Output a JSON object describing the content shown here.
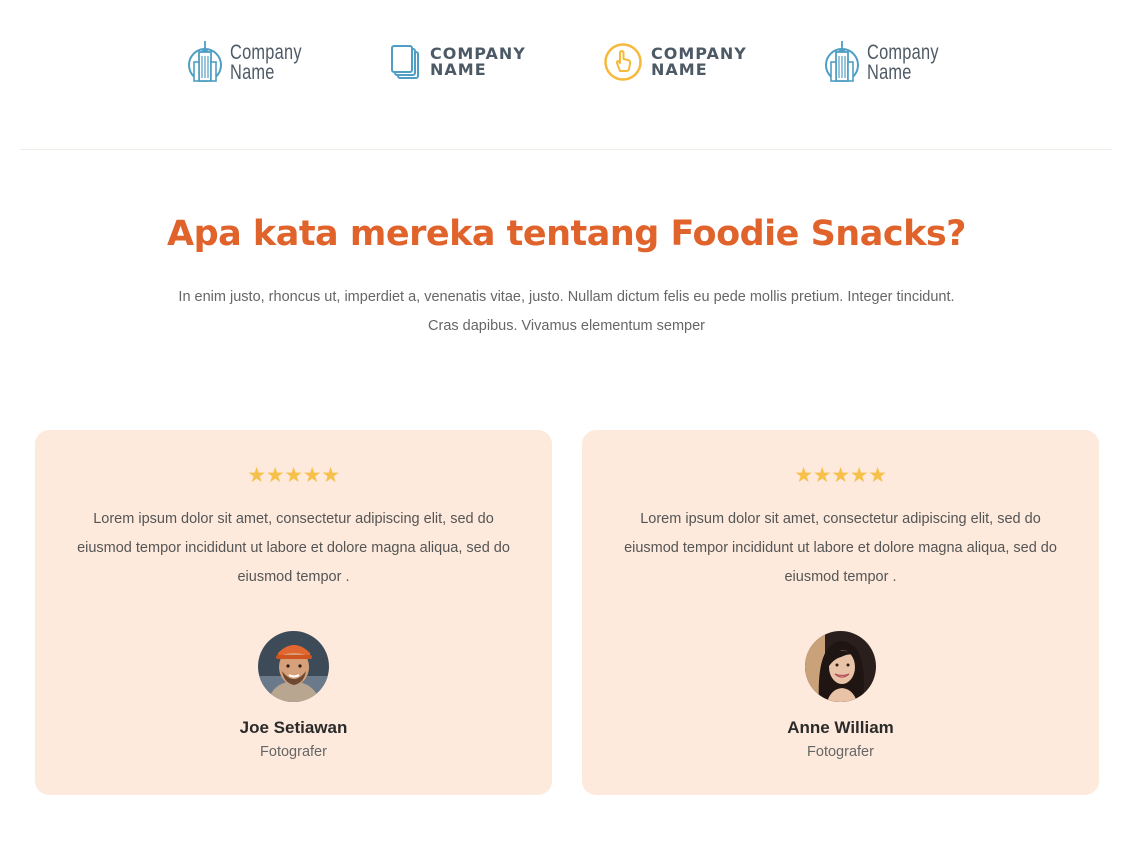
{
  "logos": [
    {
      "icon": "skyscraper-icon",
      "line1": "Company",
      "line2": "Name",
      "style": "condensed",
      "color": "#4f9ec4"
    },
    {
      "icon": "stacked-pages-icon",
      "line1": "COMPANY",
      "line2": "NAME",
      "style": "heavy",
      "color": "#4f9ec4"
    },
    {
      "icon": "pointer-hand-icon",
      "line1": "COMPANY",
      "line2": "NAME",
      "style": "heavy",
      "color": "#f6b93b"
    },
    {
      "icon": "skyscraper-icon",
      "line1": "Company",
      "line2": "Name",
      "style": "condensed",
      "color": "#4f9ec4"
    }
  ],
  "section": {
    "heading": "Apa kata mereka tentang Foodie Snacks?",
    "subheading": "In enim justo, rhoncus ut, imperdiet a, venenatis vitae, justo. Nullam dictum felis eu pede mollis pretium. Integer tincidunt. Cras dapibus. Vivamus elementum semper"
  },
  "testimonials": [
    {
      "rating": 5,
      "quote": "Lorem ipsum dolor sit amet, consectetur adipiscing elit, sed do eiusmod tempor incididunt ut labore et dolore magna aliqua, sed do eiusmod tempor .",
      "name": "Joe Setiawan",
      "role": "Fotografer"
    },
    {
      "rating": 5,
      "quote": "Lorem ipsum dolor sit amet, consectetur adipiscing elit, sed do eiusmod tempor incididunt ut labore et dolore magna aliqua, sed do eiusmod tempor .",
      "name": "Anne William",
      "role": "Fotografer"
    }
  ],
  "colors": {
    "accent": "#e0632b",
    "card_bg": "#fdeadc",
    "star": "#f7c04a",
    "logo_text": "#4d5a66"
  }
}
